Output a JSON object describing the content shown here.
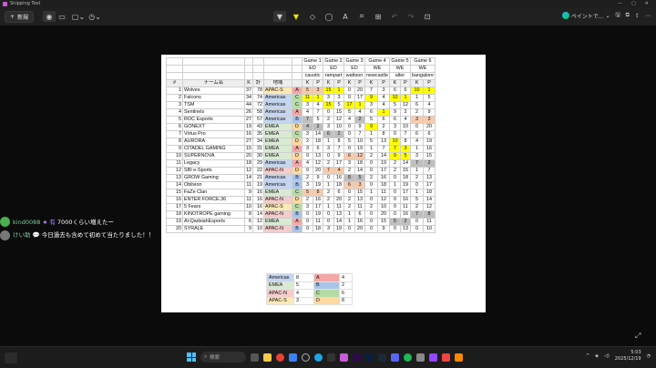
{
  "window": {
    "title": "Snipping Tool",
    "controls": [
      "—",
      "▢",
      "✕"
    ]
  },
  "toolbar": {
    "new_label": "新規",
    "edge_label": "ペイントで..."
  },
  "sheet": {
    "game_header_row1": [
      "Game 1",
      "Game 2",
      "Game 3",
      "Game 4",
      "Game 5",
      "Game 6"
    ],
    "game_header_row2": [
      "ED",
      "ED",
      "ED",
      "WE",
      "WE",
      "WE"
    ],
    "game_header_row3": [
      "caustic",
      "rampart",
      "wattson",
      "newcastle",
      "alter",
      "bangalore"
    ],
    "col_headers": {
      "num": "#",
      "team": "チーム名",
      "k": "K",
      "total": "計",
      "region": "地域",
      "kp": [
        "K",
        "P",
        "K",
        "P",
        "K",
        "P",
        "K",
        "P",
        "K",
        "P",
        "K",
        "P"
      ]
    },
    "rows": [
      {
        "n": "1",
        "team": "Wolves",
        "k": "37",
        "t": "78",
        "reg": "APAC-S",
        "grp": "A",
        "g": [
          "5",
          "3",
          "15",
          "1",
          "0",
          "20",
          "7",
          "3",
          "6",
          "6",
          "10",
          "1"
        ]
      },
      {
        "n": "2",
        "team": "Falcons",
        "k": "34",
        "t": "74",
        "reg": "Americas",
        "grp": "C",
        "g": [
          "11",
          "1",
          "3",
          "3",
          "0",
          "17",
          "9",
          "4",
          "10",
          "1",
          "1",
          "5"
        ]
      },
      {
        "n": "3",
        "team": "TSM",
        "k": "44",
        "t": "72",
        "reg": "Americas",
        "grp": "C",
        "g": [
          "3",
          "4",
          "15",
          "5",
          "17",
          "1",
          "3",
          "4",
          "5",
          "12",
          "6",
          "4"
        ]
      },
      {
        "n": "4",
        "team": "Sentinels",
        "k": "26",
        "t": "58",
        "reg": "Americas",
        "grp": "A",
        "g": [
          "4",
          "7",
          "0",
          "15",
          "5",
          "4",
          "6",
          "1",
          "9",
          "2",
          "2",
          "9"
        ]
      },
      {
        "n": "5",
        "team": "ROC Esports",
        "k": "27",
        "t": "57",
        "reg": "Americas",
        "grp": "B",
        "g": [
          "7",
          "5",
          "2",
          "12",
          "4",
          "2",
          "5",
          "6",
          "6",
          "4",
          "3",
          "3"
        ]
      },
      {
        "n": "6",
        "team": "GONEXT",
        "k": "19",
        "t": "43",
        "reg": "EMEA",
        "grp": "D",
        "g": [
          "4",
          "2",
          "3",
          "10",
          "0",
          "9",
          "9",
          "2",
          "3",
          "10",
          "0",
          "20"
        ]
      },
      {
        "n": "7",
        "team": "Virtus Pro",
        "k": "16",
        "t": "35",
        "reg": "EMEA",
        "grp": "C",
        "g": [
          "3",
          "14",
          "6",
          "2",
          "0",
          "7",
          "1",
          "8",
          "0",
          "7",
          "6",
          "6"
        ]
      },
      {
        "n": "8",
        "team": "AURORA",
        "k": "27",
        "t": "34",
        "reg": "EMEA",
        "grp": "D",
        "g": [
          "2",
          "18",
          "1",
          "8",
          "5",
          "10",
          "5",
          "13",
          "10",
          "8",
          "4",
          "19"
        ]
      },
      {
        "n": "9",
        "team": "CITADEL GAMING",
        "k": "15",
        "t": "31",
        "reg": "EMEA",
        "grp": "A",
        "g": [
          "3",
          "6",
          "3",
          "7",
          "0",
          "19",
          "1",
          "7",
          "7",
          "3",
          "1",
          "16"
        ]
      },
      {
        "n": "10",
        "team": "SUPERNOVA",
        "k": "20",
        "t": "30",
        "reg": "EMEA",
        "grp": "D",
        "g": [
          "0",
          "13",
          "0",
          "9",
          "6",
          "12",
          "2",
          "14",
          "9",
          "5",
          "3",
          "15"
        ]
      },
      {
        "n": "11",
        "team": "Legacy",
        "k": "18",
        "t": "29",
        "reg": "Americas",
        "grp": "A",
        "g": [
          "4",
          "12",
          "2",
          "17",
          "3",
          "18",
          "0",
          "19",
          "2",
          "14",
          "7",
          "2"
        ]
      },
      {
        "n": "12",
        "team": "SBI e-Sports",
        "k": "12",
        "t": "22",
        "reg": "APAC-N",
        "grp": "D",
        "g": [
          "0",
          "20",
          "7",
          "4",
          "2",
          "14",
          "0",
          "17",
          "2",
          "15",
          "1",
          "7"
        ]
      },
      {
        "n": "13",
        "team": "GROW Gaming",
        "k": "14",
        "t": "21",
        "reg": "Americas",
        "grp": "B",
        "g": [
          "2",
          "9",
          "0",
          "16",
          "8",
          "5",
          "2",
          "16",
          "0",
          "18",
          "2",
          "13"
        ]
      },
      {
        "n": "14",
        "team": "Oblivion",
        "k": "11",
        "t": "19",
        "reg": "Americas",
        "grp": "B",
        "g": [
          "3",
          "19",
          "1",
          "18",
          "6",
          "3",
          "0",
          "18",
          "1",
          "19",
          "0",
          "17"
        ]
      },
      {
        "n": "15",
        "team": "FaZe Clan",
        "k": "9",
        "t": "16",
        "reg": "EMEA",
        "grp": "C",
        "g": [
          "5",
          "8",
          "2",
          "6",
          "0",
          "15",
          "1",
          "11",
          "0",
          "17",
          "1",
          "18"
        ]
      },
      {
        "n": "16",
        "team": "ENTER FORCE.36",
        "k": "11",
        "t": "16",
        "reg": "APAC-N",
        "grp": "D",
        "g": [
          "2",
          "16",
          "2",
          "20",
          "2",
          "13",
          "0",
          "12",
          "0",
          "16",
          "5",
          "14"
        ]
      },
      {
        "n": "17",
        "team": "5 Fears",
        "k": "10",
        "t": "16",
        "reg": "APAC-S",
        "grp": "C",
        "g": [
          "3",
          "17",
          "1",
          "11",
          "2",
          "11",
          "2",
          "10",
          "0",
          "11",
          "2",
          "12"
        ]
      },
      {
        "n": "18",
        "team": "KINOTROPE gaming",
        "k": "8",
        "t": "14",
        "reg": "APAC-N",
        "grp": "B",
        "g": [
          "0",
          "19",
          "0",
          "13",
          "1",
          "6",
          "0",
          "20",
          "0",
          "16",
          "7",
          "8"
        ]
      },
      {
        "n": "19",
        "team": "Al-QadsiahEsports",
        "k": "6",
        "t": "12",
        "reg": "EMEA",
        "grp": "A",
        "g": [
          "0",
          "11",
          "0",
          "14",
          "1",
          "16",
          "0",
          "15",
          "5",
          "2",
          "0",
          "11"
        ]
      },
      {
        "n": "20",
        "team": "SYRALE",
        "k": "9",
        "t": "10",
        "reg": "APAC-N",
        "grp": "B",
        "g": [
          "0",
          "18",
          "3",
          "19",
          "0",
          "20",
          "0",
          "9",
          "0",
          "13",
          "0",
          "10"
        ]
      }
    ],
    "summary": [
      {
        "region": "Americas",
        "count": "8",
        "grp": "A",
        "gc": "4"
      },
      {
        "region": "EMEA",
        "count": "5",
        "grp": "B",
        "gc": "2"
      },
      {
        "region": "APAC-N",
        "count": "4",
        "grp": "C",
        "gc": "6"
      },
      {
        "region": "APAC-S",
        "count": "3",
        "grp": "D",
        "gc": "8"
      }
    ]
  },
  "chat": {
    "m1_user": "kind0088",
    "m1_badge": "★ 有",
    "m1_text": "7000くらい増えたー",
    "m2_user": "けい助",
    "m2_badge": "💬",
    "m2_text": "今日過去も含めて初めて当たりました！！"
  },
  "taskbar": {
    "search_placeholder": "検索",
    "time": "5:03",
    "date": "2025/12/19"
  },
  "colors": {
    "yellow": "#ffff00",
    "orange": "#f8cbad",
    "gray": "#bfbfbf",
    "A": "#f4a6a6",
    "B": "#a9c4eb",
    "C": "#b6dca6",
    "D": "#ffd9a0",
    "americas": "#c5d6f0",
    "emea": "#d9ead3",
    "apacn": "#f4cccc",
    "apacs": "#fde9b8"
  }
}
